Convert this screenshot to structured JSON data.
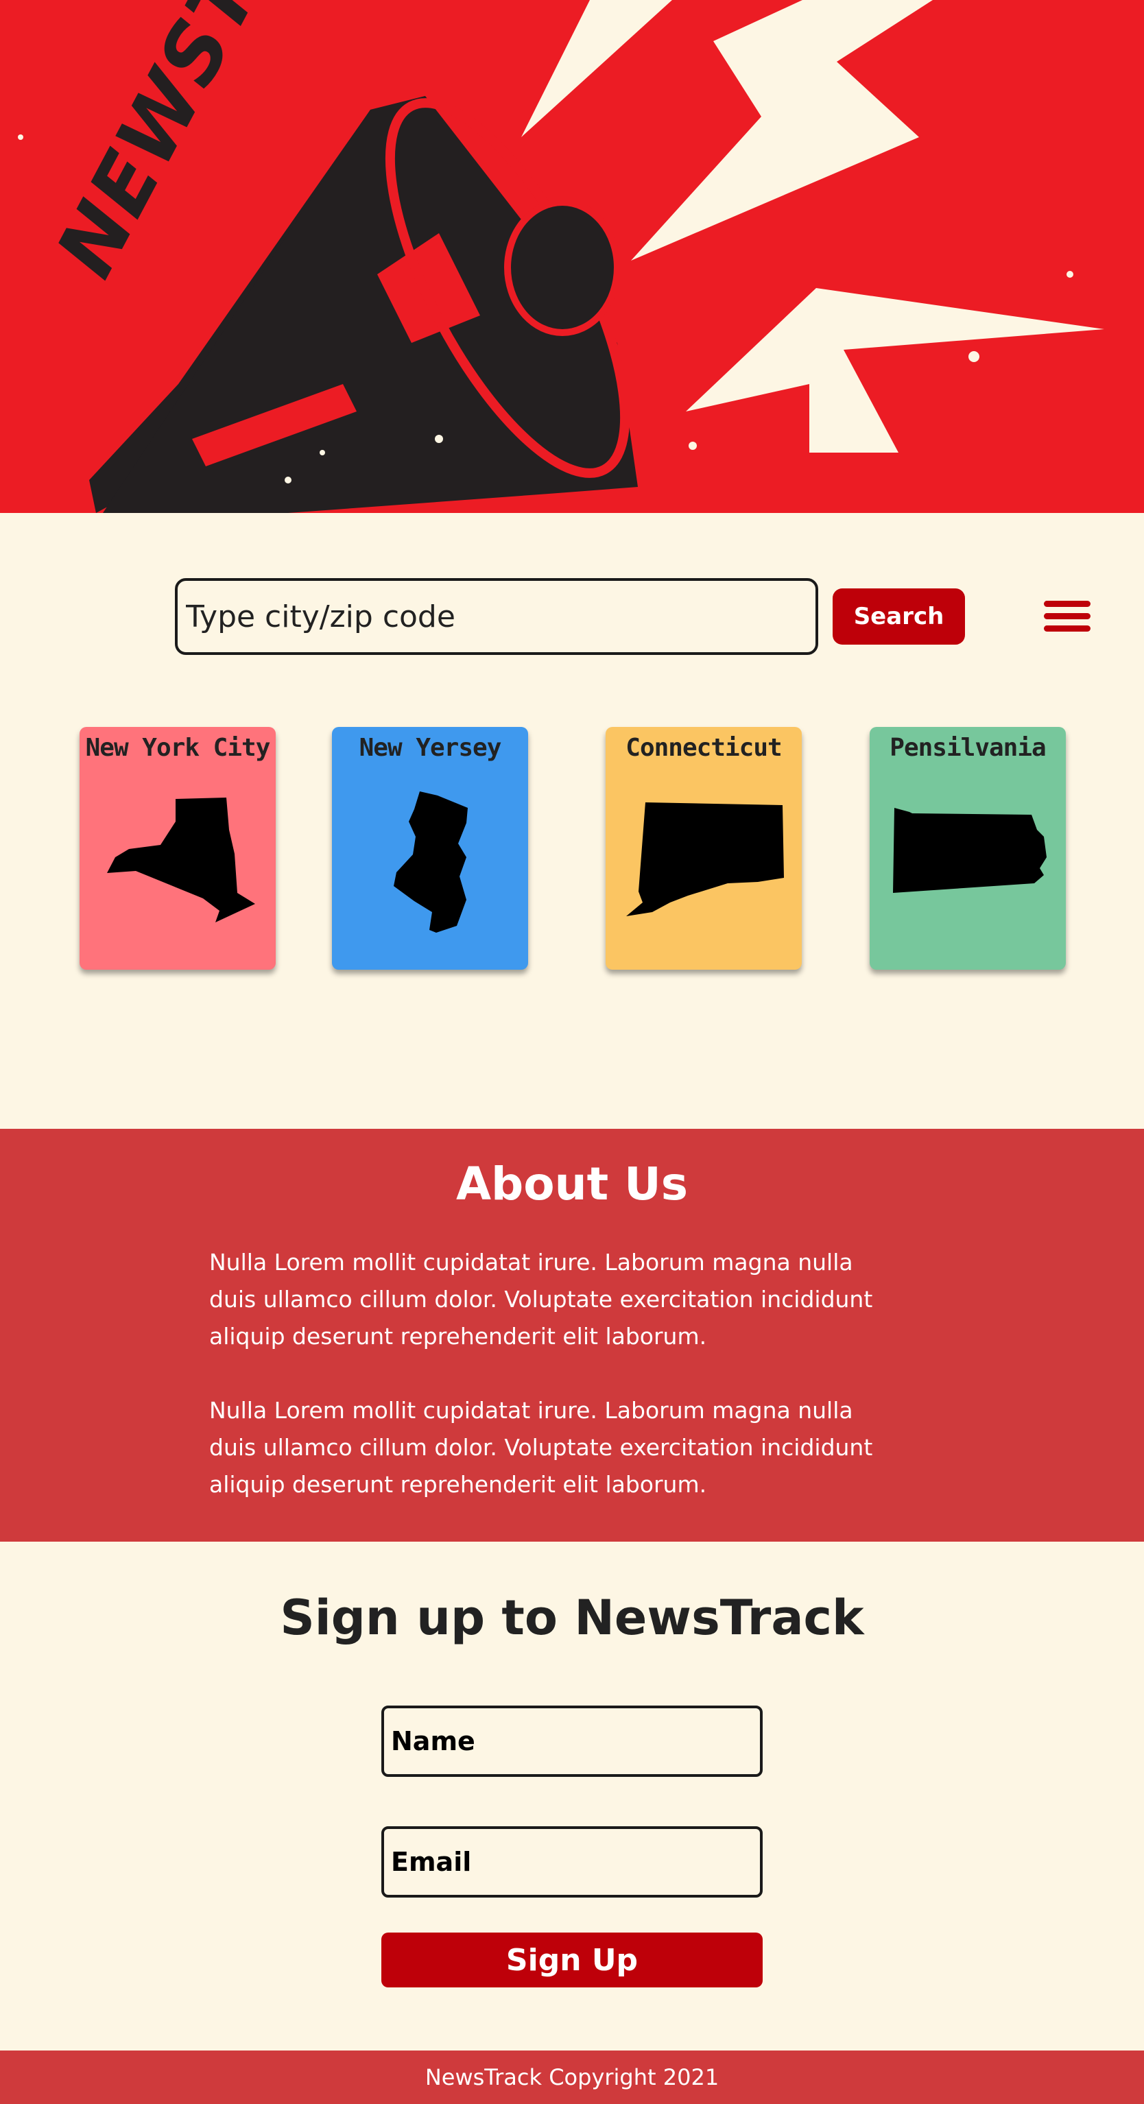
{
  "hero": {
    "logo_text": "NEWSTRACK",
    "colors": {
      "background": "#ec1c24",
      "megaphone": "#231f20",
      "bolt": "#fdf6e4"
    }
  },
  "search": {
    "placeholder": "Type city/zip code",
    "button_label": "Search"
  },
  "menu": {
    "icon": "hamburger-menu-icon"
  },
  "states": [
    {
      "name": "New York City",
      "color": "#ff737b",
      "icon": "new-york-state-icon"
    },
    {
      "name": "New Yersey",
      "color": "#3f99ee",
      "icon": "new-jersey-state-icon"
    },
    {
      "name": "Connecticut",
      "color": "#fbc562",
      "icon": "connecticut-state-icon"
    },
    {
      "name": "Pensilvania",
      "color": "#77c79c",
      "icon": "pennsylvania-state-icon"
    }
  ],
  "about": {
    "title": "About Us",
    "paragraphs": [
      "Nulla Lorem mollit cupidatat irure. Laborum magna nulla duis ullamco cillum dolor. Voluptate exercitation incididunt aliquip deserunt reprehenderit elit laborum.",
      "Nulla Lorem mollit cupidatat irure. Laborum magna nulla duis ullamco cillum dolor. Voluptate exercitation incididunt aliquip deserunt reprehenderit elit laborum."
    ]
  },
  "signup": {
    "title": "Sign up to NewsTrack",
    "name_placeholder": "Name",
    "email_placeholder": "Email",
    "button_label": "Sign Up"
  },
  "footer": {
    "text": "NewsTrack Copyright 2021"
  },
  "colors": {
    "accent": "#be0009",
    "section_red": "#cf3a3c",
    "cream": "#fdf6e4"
  }
}
